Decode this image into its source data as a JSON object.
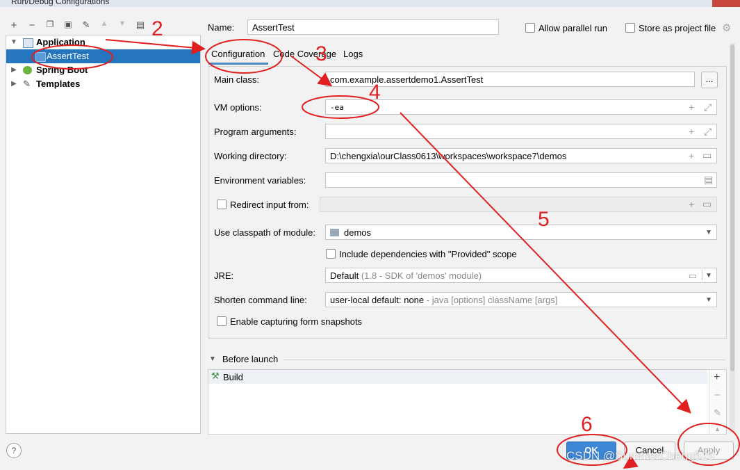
{
  "window": {
    "title": "Run/Debug Configurations"
  },
  "toolbar": {
    "add": "+",
    "remove": "−"
  },
  "tree": {
    "application": "Application",
    "assert_test": "AssertTest",
    "spring_boot": "Spring Boot",
    "templates": "Templates"
  },
  "header": {
    "name_label": "Name:",
    "name_value": "AssertTest",
    "allow_parallel": "Allow parallel run",
    "store_project": "Store as project file"
  },
  "tabs": [
    "Configuration",
    "Code Coverage",
    "Logs"
  ],
  "form": {
    "main_class_label": "Main class:",
    "main_class_value": "com.example.assertdemo1.AssertTest",
    "browse": "...",
    "vm_options_label": "VM options:",
    "vm_options_value": "-ea",
    "program_args_label": "Program arguments:",
    "working_dir_label": "Working directory:",
    "working_dir_value": "D:\\chengxia\\ourClass0613\\workspaces\\workspace7\\demos",
    "env_vars_label": "Environment variables:",
    "redirect_label": "Redirect input from:",
    "classpath_label": "Use classpath of module:",
    "classpath_value": "demos",
    "include_deps": "Include dependencies with \"Provided\" scope",
    "jre_label": "JRE:",
    "jre_value": "Default",
    "jre_hint": "(1.8 - SDK of 'demos' module)",
    "shorten_label": "Shorten command line:",
    "shorten_value": "user-local default: none",
    "shorten_hint": "- java [options] className [args]",
    "capture_label": "Enable capturing form snapshots"
  },
  "before_launch": {
    "title": "Before launch",
    "build": "Build"
  },
  "buttons": {
    "ok": "OK",
    "cancel": "Cancel",
    "apply": "Apply",
    "help": "?"
  },
  "annotations": [
    "2",
    "3",
    "4",
    "5",
    "6"
  ],
  "watermark": "CSDN @SummerCheng525",
  "colors": {
    "selection": "#2675bf",
    "annotation": "#e02020",
    "ok_button": "#3d86d6"
  }
}
